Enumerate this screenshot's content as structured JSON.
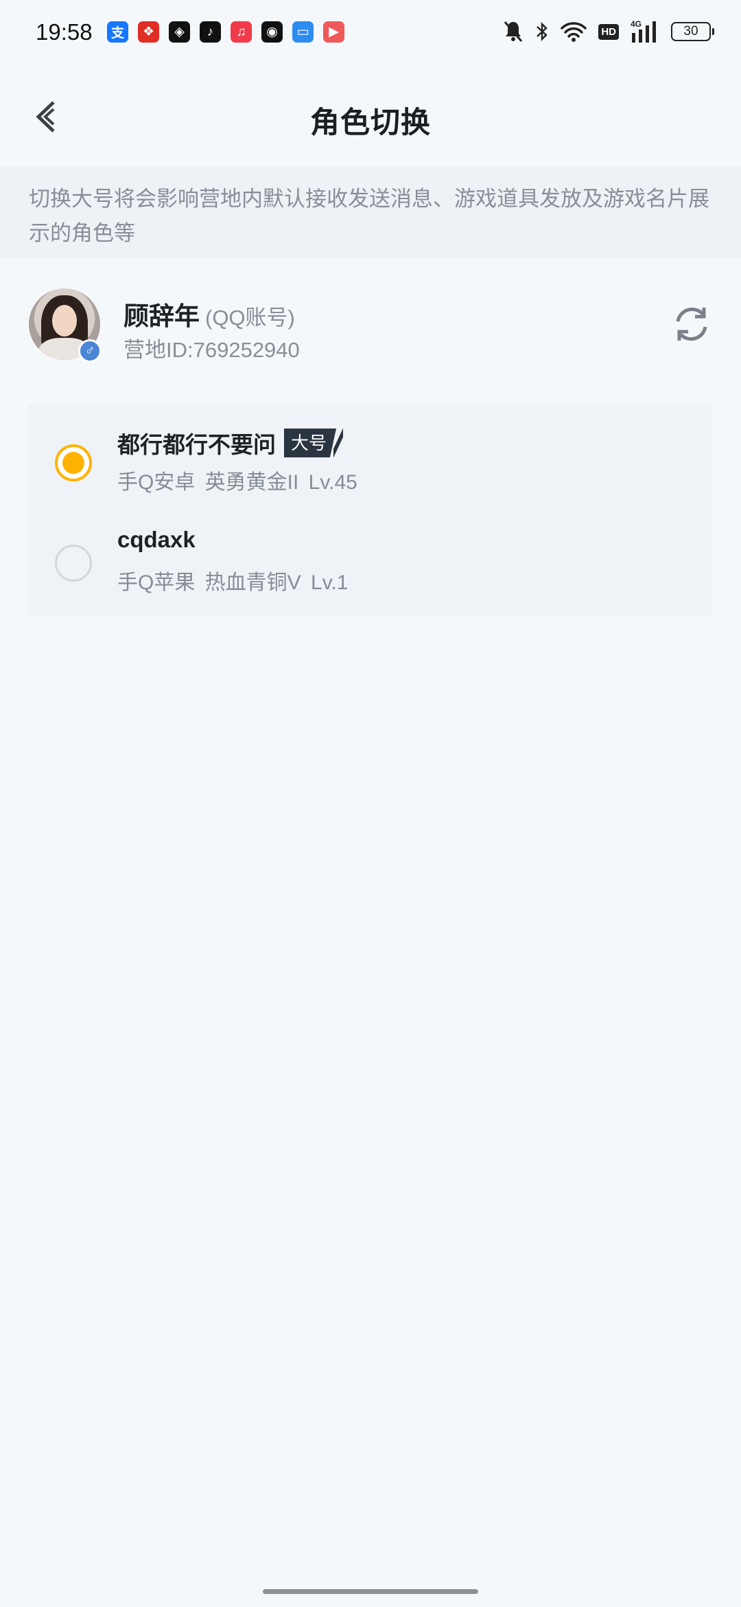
{
  "status_bar": {
    "time": "19:58",
    "apps": [
      {
        "name": "alipay-icon",
        "glyph": "支",
        "color": "#1677ff"
      },
      {
        "name": "pinduoduo-icon",
        "glyph": "❖",
        "color": "#e02e24"
      },
      {
        "name": "shield-app-icon",
        "glyph": "◈",
        "color": "#111111"
      },
      {
        "name": "tiktok-icon",
        "glyph": "♪",
        "color": "#111111"
      },
      {
        "name": "music-icon",
        "glyph": "♫",
        "color": "#f23b4a"
      },
      {
        "name": "wechat-icon",
        "glyph": "◉",
        "color": "#111111"
      },
      {
        "name": "cloud-app-icon",
        "glyph": "▭",
        "color": "#2d8cf0"
      },
      {
        "name": "video-app-icon",
        "glyph": "▶",
        "color": "#ee5a5a"
      }
    ],
    "network_label": "4G",
    "hd_label": "HD",
    "battery_level": "30"
  },
  "header": {
    "title": "角色切换"
  },
  "notice": {
    "text": "切换大号将会影响营地内默认接收发送消息、游戏道具发放及游戏名片展示的角色等"
  },
  "account": {
    "name": "顾辞年",
    "type": "(QQ账号)",
    "camp_id": "营地ID:769252940",
    "gender_symbol": "♂"
  },
  "roles": [
    {
      "name": "都行都行不要问",
      "badge": "大号",
      "meta": "手Q安卓  英勇黄金II  Lv.45",
      "selected": true
    },
    {
      "name": "cqdaxk",
      "badge": "",
      "meta": "手Q苹果  热血青铜V  Lv.1",
      "selected": false
    }
  ],
  "colors": {
    "accent": "#ffb300",
    "badge_bg": "#2b3441",
    "gender_badge": "#4c86d6"
  }
}
